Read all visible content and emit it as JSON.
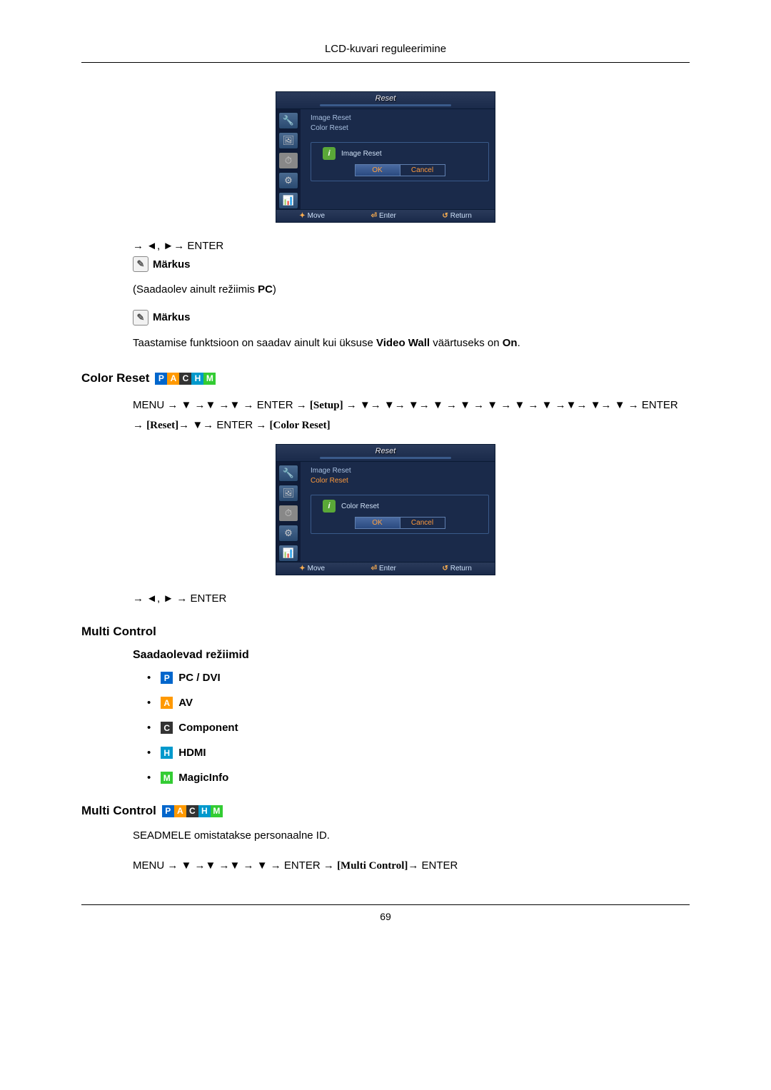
{
  "header": {
    "title": "LCD-kuvari reguleerimine"
  },
  "footer": {
    "page": "69"
  },
  "osd1": {
    "title": "Reset",
    "items": [
      "Image Reset",
      "Color Reset"
    ],
    "dialog_label": "Image Reset",
    "ok": "OK",
    "cancel": "Cancel",
    "foot_move": "Move",
    "foot_enter": "Enter",
    "foot_return": "Return"
  },
  "nav1": "→ ◄, ►→ ENTER",
  "note_label": "Märkus",
  "para1_pre": "(Saadaolev ainult režiimis ",
  "para1_bold": "PC",
  "para1_post": ")",
  "para2_pre": "Taastamise funktsioon on saadav ainult kui üksuse ",
  "para2_bold1": "Video Wall",
  "para2_mid": " väärtuseks on ",
  "para2_bold2": "On",
  "para2_post": ".",
  "section_color_reset": "Color Reset",
  "menu_path_color": {
    "p": "MENU → ▼ →▼ →▼ → ENTER → ",
    "br1": "[Setup]",
    "p2": " → ▼→ ▼→ ▼→ ▼ → ▼ → ▼ → ▼ → ▼ →▼→ ▼→ ▼ → ENTER → ",
    "br2": "[Reset]",
    "p3": "→ ▼→ ENTER → ",
    "br3": "[Color Reset]"
  },
  "osd2": {
    "title": "Reset",
    "items": [
      "Image Reset",
      "Color Reset"
    ],
    "dialog_label": "Color Reset",
    "ok": "OK",
    "cancel": "Cancel",
    "foot_move": "Move",
    "foot_enter": "Enter",
    "foot_return": "Return"
  },
  "nav2": "→ ◄, ► → ENTER",
  "section_multi": "Multi Control",
  "subhead_modes": "Saadaolevad režiimid",
  "modes": {
    "pc": "PC / DVI",
    "av": "AV",
    "comp": "Component",
    "hdmi": "HDMI",
    "magic": "MagicInfo"
  },
  "section_multi2": "Multi Control",
  "para3": "SEADMELE omistatakse personaalne ID.",
  "menu_path_multi": {
    "p": "MENU → ▼ →▼ →▼ → ▼ → ENTER → ",
    "br": "[Multi Control]",
    "p2": "→ ENTER"
  }
}
